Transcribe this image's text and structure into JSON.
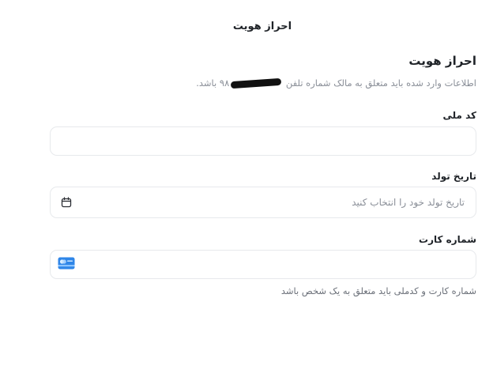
{
  "header": {
    "title": "احراز هویت"
  },
  "main": {
    "heading": "احراز هویت",
    "description_before": "اطلاعات وارد شده باید متعلق به مالک شماره تلفن ",
    "description_after": "۹۸ باشد.",
    "national_code": {
      "label": "کد ملی",
      "value": "",
      "placeholder": ""
    },
    "birth_date": {
      "label": "تاریخ تولد",
      "value": "",
      "placeholder": "تاریخ تولد خود را انتخاب کنید",
      "icon": "calendar-icon"
    },
    "card_number": {
      "label": "شماره کارت",
      "value": "",
      "placeholder": "",
      "icon": "bank-card-icon"
    },
    "hint": "شماره کارت و کدملی باید متعلق به یک شخص باشد"
  },
  "colors": {
    "border": "#e7e9ec",
    "muted_text": "#8a8f98",
    "card_blue": "#2f86e8"
  }
}
